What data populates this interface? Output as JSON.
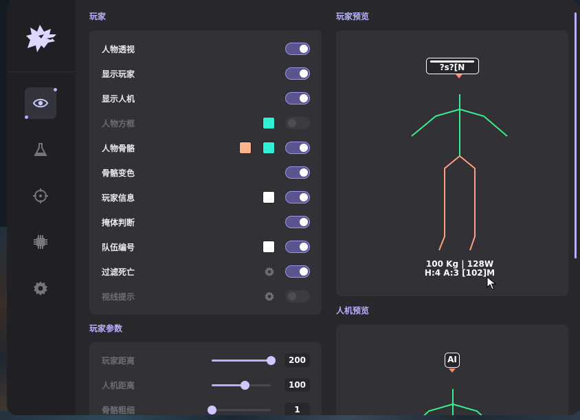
{
  "sections": {
    "player": "玩家",
    "player_preview": "玩家预览",
    "player_params": "玩家参数",
    "bot_preview": "人机预览"
  },
  "player_options": [
    {
      "label": "人物透视",
      "enabled": true,
      "dim": false
    },
    {
      "label": "显示玩家",
      "enabled": true,
      "dim": false
    },
    {
      "label": "显示人机",
      "enabled": true,
      "dim": false
    },
    {
      "label": "人物方框",
      "enabled": false,
      "dim": true,
      "colors": [
        "#2ff0d4"
      ]
    },
    {
      "label": "人物骨骼",
      "enabled": true,
      "dim": false,
      "colors": [
        "#ffb48e",
        "#2ff0d4"
      ]
    },
    {
      "label": "骨骼变色",
      "enabled": true,
      "dim": false
    },
    {
      "label": "玩家信息",
      "enabled": true,
      "dim": false,
      "colors": [
        "#ffffff"
      ]
    },
    {
      "label": "掩体判断",
      "enabled": true,
      "dim": false
    },
    {
      "label": "队伍编号",
      "enabled": true,
      "dim": false,
      "colors": [
        "#ffffff"
      ]
    },
    {
      "label": "过滤死亡",
      "enabled": true,
      "dim": false,
      "icon": "gear-icon"
    },
    {
      "label": "视线提示",
      "enabled": false,
      "dim": true,
      "icon": "gear-icon"
    }
  ],
  "player_params": [
    {
      "label": "玩家距离",
      "value": "200",
      "fraction": 1.0
    },
    {
      "label": "人机距离",
      "value": "100",
      "fraction": 0.56
    },
    {
      "label": "骨骼粗细",
      "value": "1",
      "fraction": 0.0
    }
  ],
  "player_preview": {
    "tag": "?s?[N",
    "info_line1": "100 Kg | 128W",
    "info_line2": "H:4 A:3 [102]M"
  },
  "bot_preview": {
    "tag": "AI"
  },
  "nav": [
    {
      "name": "eye-icon",
      "active": true
    },
    {
      "name": "flask-icon",
      "active": false
    },
    {
      "name": "crosshair-icon",
      "active": false
    },
    {
      "name": "chip-icon",
      "active": false
    },
    {
      "name": "gear-icon",
      "active": false
    }
  ],
  "colors": {
    "accent": "#b7b0ff",
    "skeleton_upper": "#35f08c",
    "skeleton_lower": "#ff9f80",
    "tag_pointer": "#ff8c69"
  }
}
